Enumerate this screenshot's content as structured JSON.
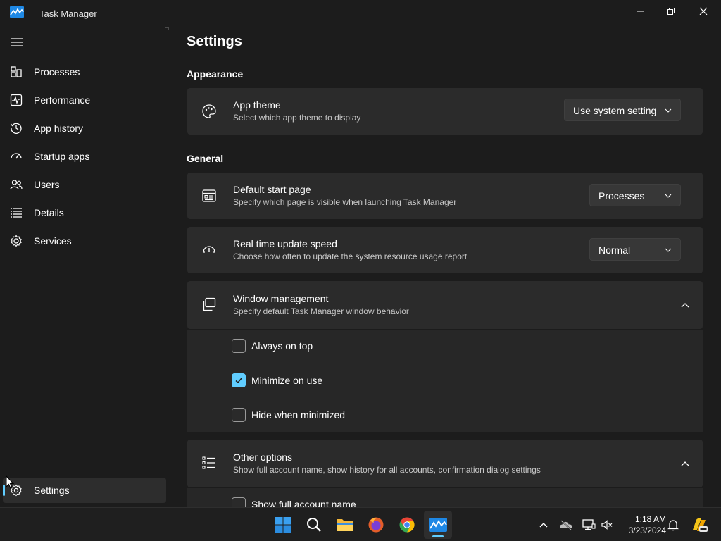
{
  "window": {
    "title": "Task Manager"
  },
  "sidebar": {
    "items": [
      {
        "label": "Processes",
        "icon": "processes-icon"
      },
      {
        "label": "Performance",
        "icon": "performance-icon"
      },
      {
        "label": "App history",
        "icon": "app-history-icon"
      },
      {
        "label": "Startup apps",
        "icon": "startup-apps-icon"
      },
      {
        "label": "Users",
        "icon": "users-icon"
      },
      {
        "label": "Details",
        "icon": "details-icon"
      },
      {
        "label": "Services",
        "icon": "services-icon"
      }
    ],
    "settings_label": "Settings"
  },
  "main": {
    "page_title": "Settings",
    "appearance": {
      "heading": "Appearance",
      "app_theme": {
        "title": "App theme",
        "description": "Select which app theme to display",
        "value": "Use system setting"
      }
    },
    "general": {
      "heading": "General",
      "default_start_page": {
        "title": "Default start page",
        "description": "Specify which page is visible when launching Task Manager",
        "value": "Processes"
      },
      "update_speed": {
        "title": "Real time update speed",
        "description": "Choose how often to update the system resource usage report",
        "value": "Normal"
      },
      "window_management": {
        "title": "Window management",
        "description": "Specify default Task Manager window behavior",
        "options": [
          {
            "label": "Always on top",
            "checked": false
          },
          {
            "label": "Minimize on use",
            "checked": true
          },
          {
            "label": "Hide when minimized",
            "checked": false
          }
        ]
      },
      "other_options": {
        "title": "Other options",
        "description": "Show full account name, show history for all accounts, confirmation dialog settings",
        "options": [
          {
            "label": "Show full account name",
            "checked": false
          }
        ]
      }
    }
  },
  "taskbar": {
    "time": "1:18 AM",
    "date": "3/23/2024"
  },
  "colors": {
    "accent": "#60cdff",
    "background": "#1c1c1c",
    "card": "#2b2b2b"
  }
}
